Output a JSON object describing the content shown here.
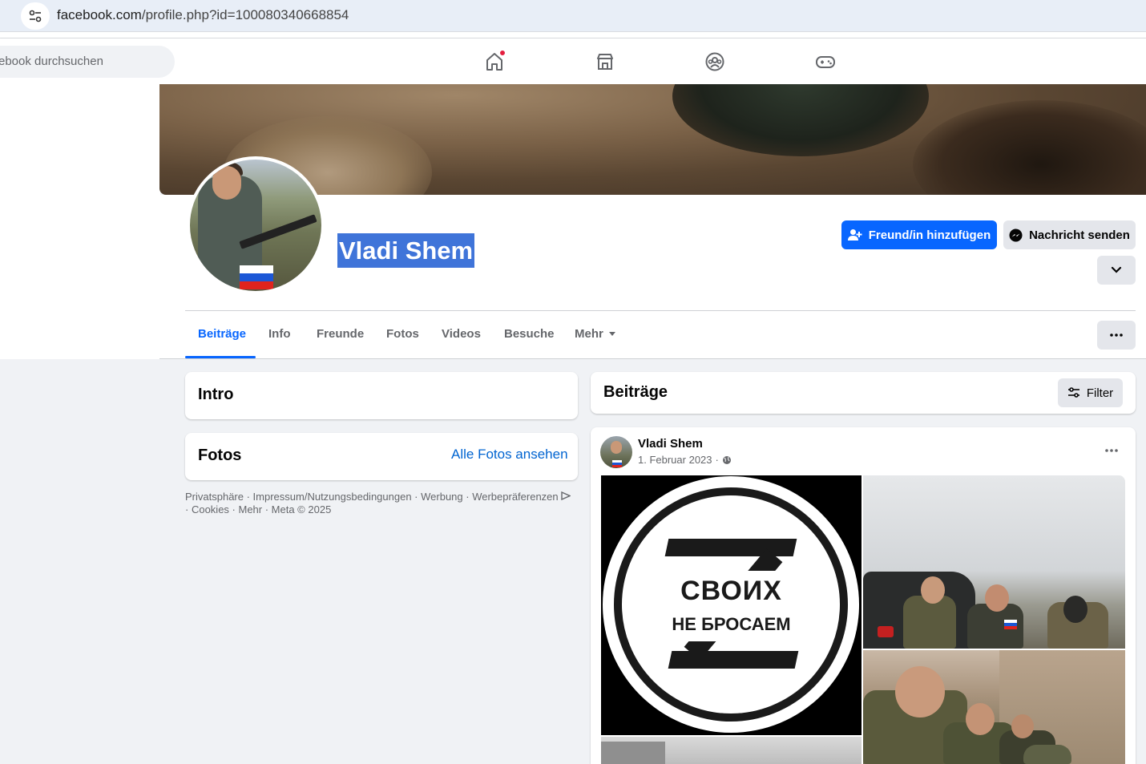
{
  "browser": {
    "url_domain": "facebook.com",
    "url_path": "/profile.php?id=100080340668854"
  },
  "header": {
    "search_placeholder": "ebook durchsuchen",
    "nav_icons": [
      "home-icon",
      "marketplace-icon",
      "groups-icon",
      "gaming-icon"
    ]
  },
  "profile": {
    "name": "Vladi Shem",
    "add_friend_label": "Freund/in hinzufügen",
    "message_label": "Nachricht senden",
    "tabs": [
      {
        "label": "Beiträge"
      },
      {
        "label": "Info"
      },
      {
        "label": "Freunde"
      },
      {
        "label": "Fotos"
      },
      {
        "label": "Videos"
      },
      {
        "label": "Besuche"
      },
      {
        "label": "Mehr"
      }
    ],
    "active_tab": "Beiträge"
  },
  "left": {
    "intro_title": "Intro",
    "photos_title": "Fotos",
    "photos_link": "Alle Fotos ansehen",
    "footer": {
      "privacy": "Privatsphäre",
      "terms": "Impressum/Nutzungsbedingungen",
      "ads": "Werbung",
      "ad_choices": "Werbepräferenzen",
      "cookies": "Cookies",
      "more": "Mehr",
      "copyright": "Meta © 2025"
    }
  },
  "posts": {
    "title": "Beiträge",
    "filter_label": "Filter",
    "post": {
      "author": "Vladi Shem",
      "date": "1. Februar 2023",
      "image_text_line1": "СВОИХ",
      "image_text_line2": "НЕ БРОСАЕМ"
    }
  },
  "colors": {
    "accent": "#0866ff",
    "link": "#0064d1",
    "background": "#f0f2f5",
    "selection": "#3f74d9"
  }
}
